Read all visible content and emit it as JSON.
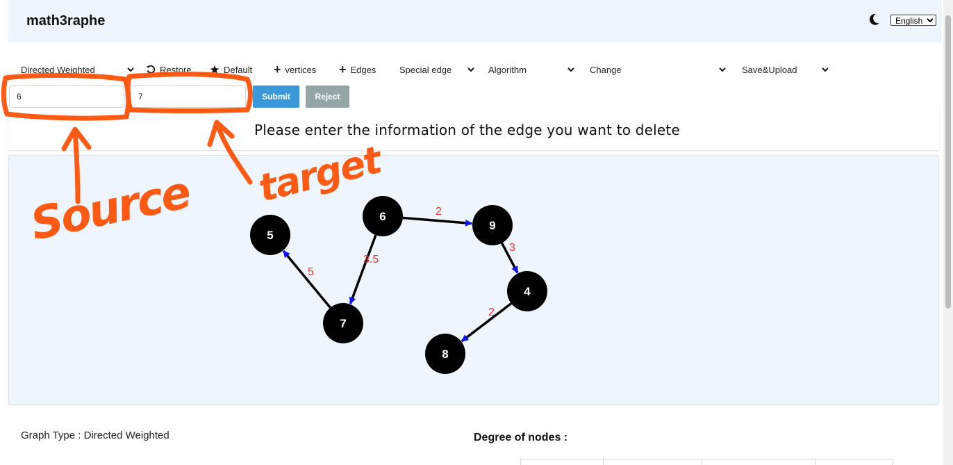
{
  "app": {
    "brand": "math3raphe",
    "language": "English"
  },
  "toolbar": {
    "graph_type": "Directed Weighted",
    "restore": "Restore",
    "default": "Default",
    "vertices": "vertices",
    "edges": "Edges",
    "special_edge": "Special edge",
    "algorithm": "Algorithm",
    "change": "Change",
    "save_upload": "Save&Upload"
  },
  "form": {
    "source_value": "6",
    "target_value": "7",
    "submit": "Submit",
    "reject": "Reject"
  },
  "message": "Please enter the information of the edge you want to delete",
  "graph": {
    "nodes": [
      "5",
      "6",
      "9",
      "4",
      "7",
      "8"
    ],
    "edges": [
      {
        "from": "6",
        "to": "9",
        "weight": "2"
      },
      {
        "from": "9",
        "to": "4",
        "weight": "3"
      },
      {
        "from": "6",
        "to": "7",
        "weight": "3.5"
      },
      {
        "from": "7",
        "to": "5",
        "weight": "5"
      },
      {
        "from": "4",
        "to": "8",
        "weight": "2"
      }
    ]
  },
  "info": {
    "graph_type_line": "Graph Type : Directed Weighted",
    "degree_title": "Degree of nodes :"
  },
  "annotations": {
    "source": "Source",
    "target": "target"
  },
  "colors": {
    "annotation": "#ff5a14",
    "edge_weight": "#ff2a2a",
    "arrow_head": "#1010ff",
    "node": "#000000",
    "submit": "#3a9ad9",
    "reject": "#95a5a6",
    "header_bg": "#eef5fd"
  }
}
